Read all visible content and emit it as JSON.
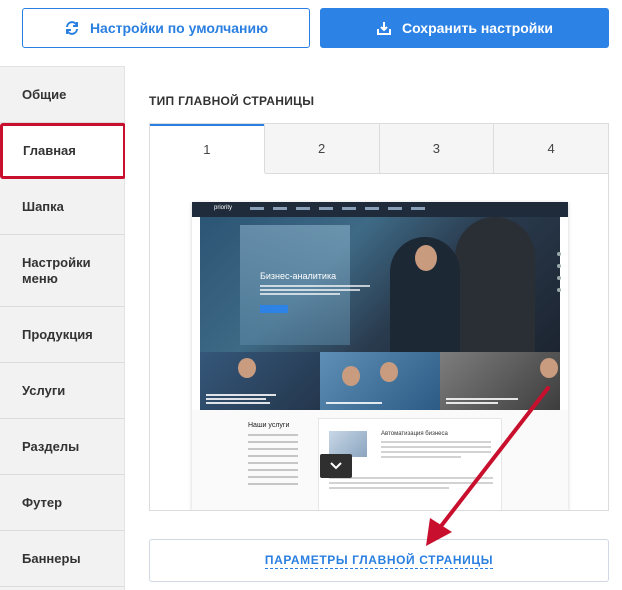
{
  "toolbar": {
    "default_label": "Настройки по умолчанию",
    "save_label": "Сохранить настройки"
  },
  "sidebar": {
    "items": [
      {
        "label": "Общие"
      },
      {
        "label": "Главная"
      },
      {
        "label": "Шапка"
      },
      {
        "label": "Настройки меню"
      },
      {
        "label": "Продукция"
      },
      {
        "label": "Услуги"
      },
      {
        "label": "Разделы"
      },
      {
        "label": "Футер"
      },
      {
        "label": "Баннеры"
      }
    ],
    "active_index": 1
  },
  "main": {
    "section_title": "ТИП ГЛАВНОЙ СТРАНИЦЫ",
    "tabs": [
      {
        "label": "1"
      },
      {
        "label": "2"
      },
      {
        "label": "3"
      },
      {
        "label": "4"
      }
    ],
    "active_tab": 0,
    "preview": {
      "logo": "priority",
      "hero_title": "Бизнес-аналитика",
      "services_title": "Наши услуги",
      "card_title": "Автоматизация бизнеса"
    },
    "params_label": "ПАРАМЕТРЫ ГЛАВНОЙ СТРАНИЦЫ"
  },
  "colors": {
    "accent": "#2d82e6",
    "highlight": "#c8102e",
    "sidebar_bg": "#f2f2f2"
  }
}
